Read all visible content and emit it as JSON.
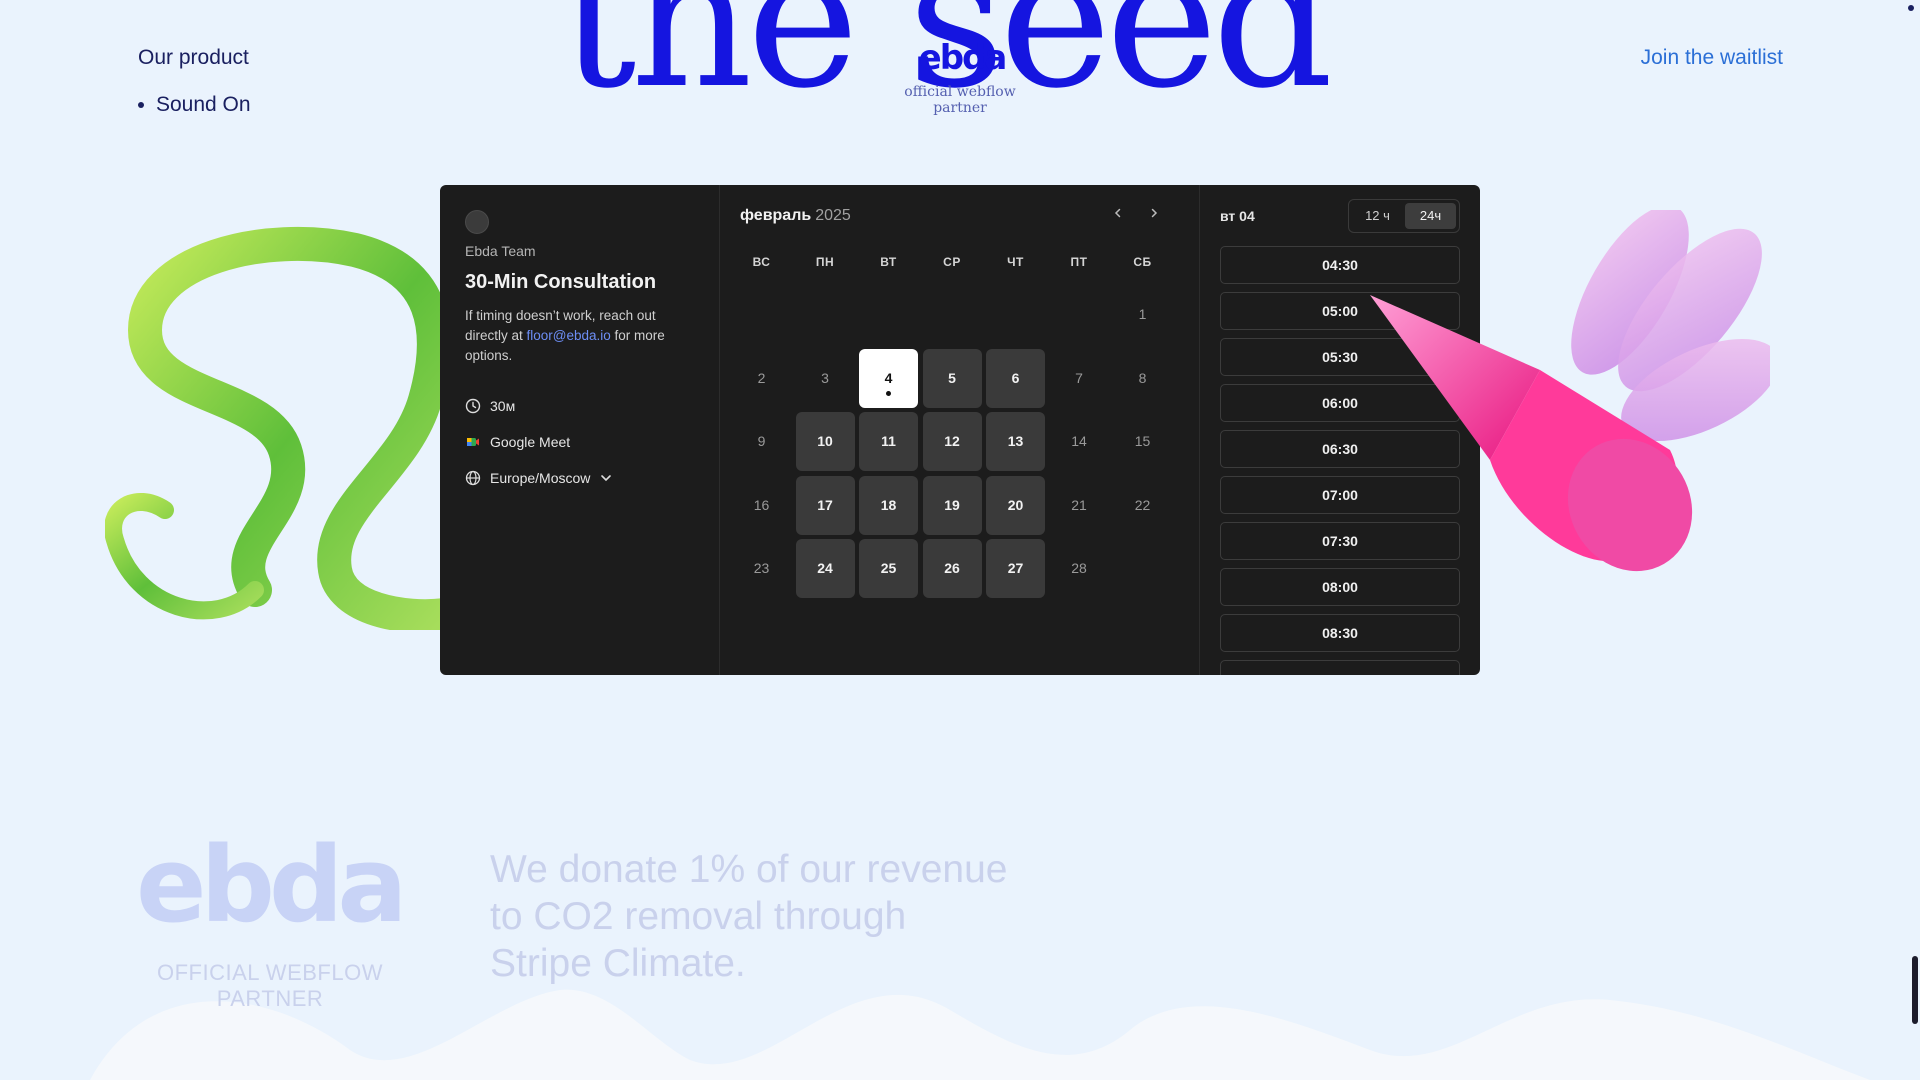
{
  "header": {
    "hero_word": "the seed",
    "hero_logo": "ebda",
    "hero_partner": "official webflow partner",
    "nav_product": "Our product",
    "nav_items": [
      "Sound On"
    ],
    "waitlist": "Join the waitlist"
  },
  "booking": {
    "team": "Ebda Team",
    "title": "30-Min Consultation",
    "desc_before": "If timing doesn’t work, reach out directly at ",
    "desc_email": "floor@ebda.io",
    "desc_after": " for more options.",
    "duration": "30м",
    "location": "Google Meet",
    "timezone": "Europe/Moscow",
    "calendar": {
      "month": "февраль",
      "year": "2025",
      "weekdays": [
        "ВС",
        "ПН",
        "ВТ",
        "СР",
        "ЧТ",
        "ПТ",
        "СБ"
      ],
      "days": [
        {
          "n": "1",
          "state": "off"
        },
        {
          "n": "2",
          "state": "off"
        },
        {
          "n": "3",
          "state": "off"
        },
        {
          "n": "4",
          "state": "selected"
        },
        {
          "n": "5",
          "state": "available"
        },
        {
          "n": "6",
          "state": "available"
        },
        {
          "n": "7",
          "state": "off"
        },
        {
          "n": "8",
          "state": "off"
        },
        {
          "n": "9",
          "state": "off"
        },
        {
          "n": "10",
          "state": "available"
        },
        {
          "n": "11",
          "state": "available"
        },
        {
          "n": "12",
          "state": "available"
        },
        {
          "n": "13",
          "state": "available"
        },
        {
          "n": "14",
          "state": "off"
        },
        {
          "n": "15",
          "state": "off"
        },
        {
          "n": "16",
          "state": "off"
        },
        {
          "n": "17",
          "state": "available"
        },
        {
          "n": "18",
          "state": "available"
        },
        {
          "n": "19",
          "state": "available"
        },
        {
          "n": "20",
          "state": "available"
        },
        {
          "n": "21",
          "state": "off"
        },
        {
          "n": "22",
          "state": "off"
        },
        {
          "n": "23",
          "state": "off"
        },
        {
          "n": "24",
          "state": "available"
        },
        {
          "n": "25",
          "state": "available"
        },
        {
          "n": "26",
          "state": "available"
        },
        {
          "n": "27",
          "state": "available"
        },
        {
          "n": "28",
          "state": "off"
        }
      ],
      "first_weekday_index": 6
    },
    "slots_date": "вт 04",
    "format_options": [
      "12 ч",
      "24ч"
    ],
    "format_selected": "24ч",
    "slots": [
      "04:30",
      "05:00",
      "05:30",
      "06:00",
      "06:30",
      "07:00",
      "07:30",
      "08:00",
      "08:30"
    ]
  },
  "footer": {
    "logo": "ebda",
    "partner": "OFFICIAL WEBFLOW PARTNER",
    "donation": "We donate 1% of our revenue to CO2 removal through Stripe Climate."
  },
  "colors": {
    "page_bg": "#eaf3fd",
    "brand_blue": "#1515e0",
    "widget_bg": "#1c1c1c",
    "available_day": "#3a3a3a",
    "link": "#6d8ef5"
  },
  "icons": {
    "duration": "clock-icon",
    "location": "google-meet-icon",
    "timezone": "globe-icon",
    "timezone_toggle": "chevron-down-icon",
    "prev_month": "chevron-left-icon",
    "next_month": "chevron-right-icon"
  }
}
